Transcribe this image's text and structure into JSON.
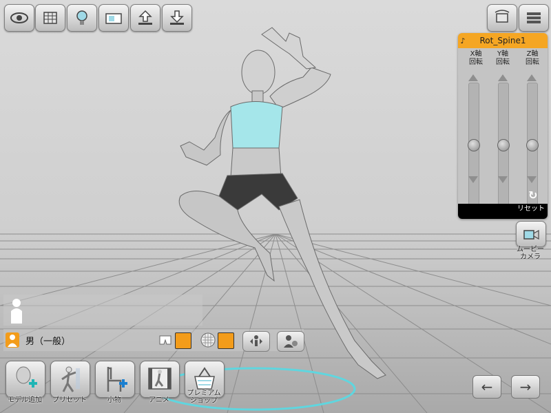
{
  "app": {
    "character": "男（一般）"
  },
  "top_toolbar": [
    {
      "name": "eye-view-button",
      "icon": "eye-icon"
    },
    {
      "name": "grid-cube-button",
      "icon": "grid-cube-icon"
    },
    {
      "name": "light-bulb-button",
      "icon": "light-bulb-icon"
    },
    {
      "name": "background-button",
      "icon": "background-icon"
    },
    {
      "name": "upload-button",
      "icon": "upload-icon"
    },
    {
      "name": "download-button",
      "icon": "download-icon"
    }
  ],
  "top_right": [
    {
      "name": "rotate-view-button",
      "icon": "rotate-view-icon"
    },
    {
      "name": "menu-button",
      "icon": "menu-icon"
    }
  ],
  "rotation_panel": {
    "title": "Rot_Spine1",
    "axes": [
      {
        "label_line1": "X軸",
        "label_line2": "回転",
        "value": 0.5
      },
      {
        "label_line1": "Y軸",
        "label_line2": "回転",
        "value": 0.5
      },
      {
        "label_line1": "Z軸",
        "label_line2": "回転",
        "value": 0.5
      }
    ],
    "reset_icon": "↻",
    "reset_label": "リセット"
  },
  "movie_camera": {
    "line1": "ムービー",
    "line2": "カメラ"
  },
  "model_row": {
    "name": "男（一般）",
    "swatch_color": "#f39c1a"
  },
  "bottom_toolbar": [
    {
      "name": "add-model-button",
      "label_line1": "モデル追加",
      "label_line2": ""
    },
    {
      "name": "preset-button",
      "label_line1": "プリセット",
      "label_line2": ""
    },
    {
      "name": "props-button",
      "label_line1": "小物",
      "label_line2": ""
    },
    {
      "name": "anime-button",
      "label_line1": "アニメ",
      "label_line2": ""
    },
    {
      "name": "premium-shop-button",
      "label_line1": "プレミアム",
      "label_line2": "ショップ"
    }
  ],
  "nav": {
    "prev": "←",
    "next": "→"
  },
  "colors": {
    "accent": "#f5a623",
    "swatch": "#f39c1a",
    "add": "#1fb5b5",
    "floor_line": "#8c8c8c"
  }
}
